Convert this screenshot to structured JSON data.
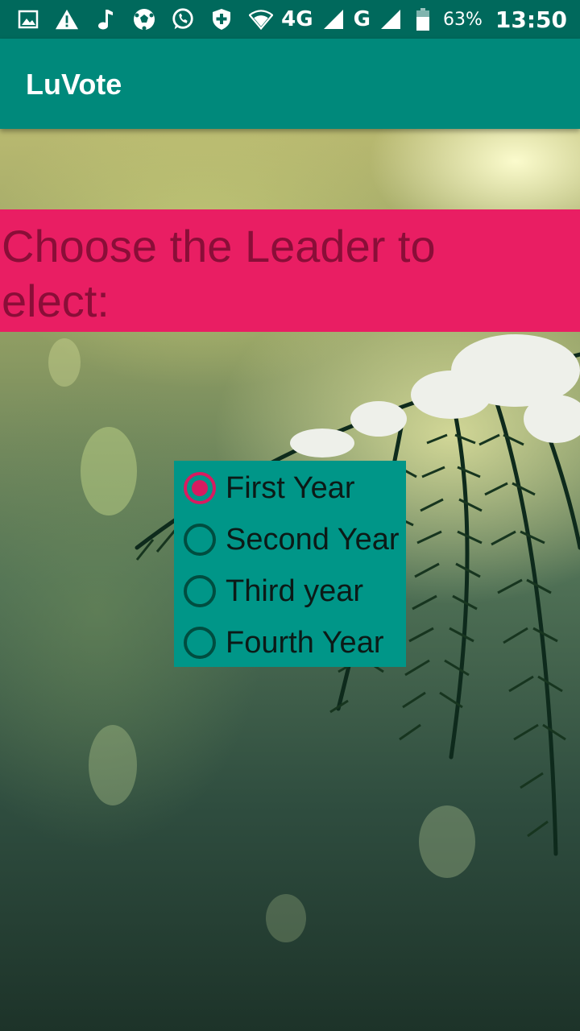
{
  "status_bar": {
    "network_label": "4G",
    "carrier_label": "G",
    "battery_percent": "63%",
    "time": "13:50",
    "icons": [
      "image-icon",
      "warning-icon",
      "music-note-icon",
      "soccer-ball-icon",
      "whatsapp-icon",
      "shield-plus-icon",
      "wifi-icon",
      "signal-icon",
      "signal-icon",
      "battery-icon"
    ]
  },
  "app_bar": {
    "title": "LuVote"
  },
  "banner": {
    "line1": "Choose the Leader to",
    "line2": "elect:"
  },
  "radio_group": {
    "selected_index": 0,
    "options": [
      {
        "label": "First Year",
        "checked": true
      },
      {
        "label": "Second Year",
        "checked": false
      },
      {
        "label": "Third year",
        "checked": false
      },
      {
        "label": "Fourth Year",
        "checked": false
      }
    ]
  },
  "colors": {
    "status_bar": "#00695c",
    "app_bar": "#00897b",
    "banner": "#e91e63",
    "banner_text": "#8a0e38",
    "radio_group": "#009688",
    "radio_accent": "#d81b60"
  }
}
